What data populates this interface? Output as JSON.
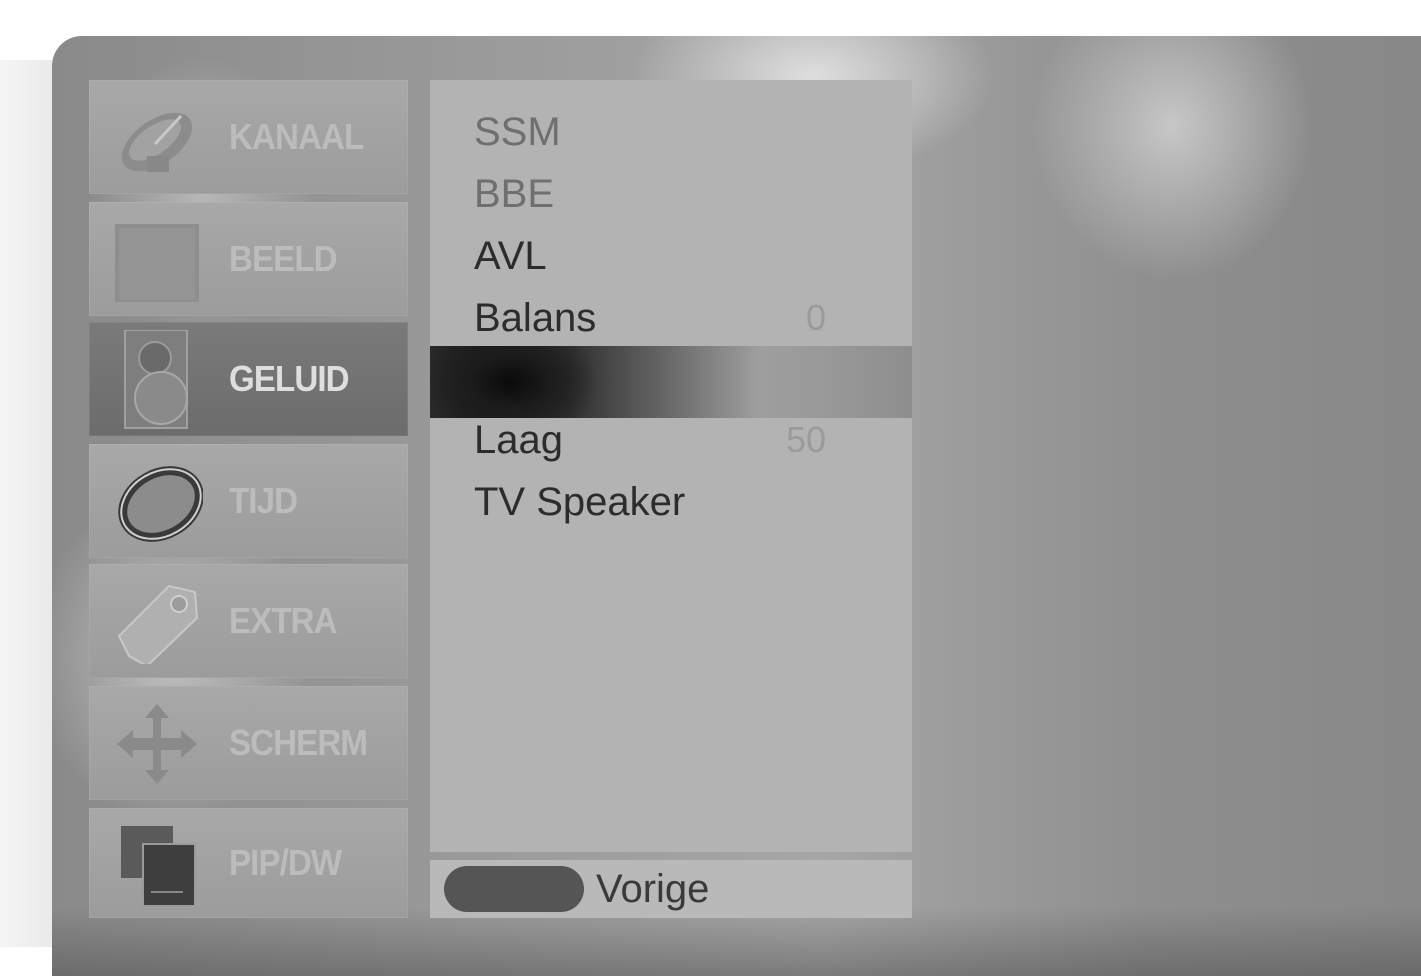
{
  "sidebar": {
    "items": [
      {
        "label": "KANAAL",
        "icon": "satellite-dish-icon"
      },
      {
        "label": "BEELD",
        "icon": "picture-icon"
      },
      {
        "label": "GELUID",
        "icon": "speaker-icon"
      },
      {
        "label": "TIJD",
        "icon": "clock-icon"
      },
      {
        "label": "EXTRA",
        "icon": "tag-icon"
      },
      {
        "label": "SCHERM",
        "icon": "move-arrows-icon"
      },
      {
        "label": "PIP/DW",
        "icon": "pip-windows-icon"
      }
    ],
    "active": "GELUID"
  },
  "menu": {
    "items": [
      {
        "label": "SSM",
        "value": ""
      },
      {
        "label": "BBE",
        "value": ""
      },
      {
        "label": "AVL",
        "value": ""
      },
      {
        "label": "Balans",
        "value": "0"
      },
      {
        "label": "",
        "value": ""
      },
      {
        "label": "Laag",
        "value": "50"
      },
      {
        "label": "TV Speaker",
        "value": ""
      }
    ]
  },
  "footer": {
    "button_icon": "menu-button-icon",
    "label": "Vorige"
  },
  "colors": {
    "panel": "#b3b3b3",
    "active_item": "#6c6c6c",
    "highlight": "#1a1a1a",
    "text": "#2c2c2c"
  }
}
